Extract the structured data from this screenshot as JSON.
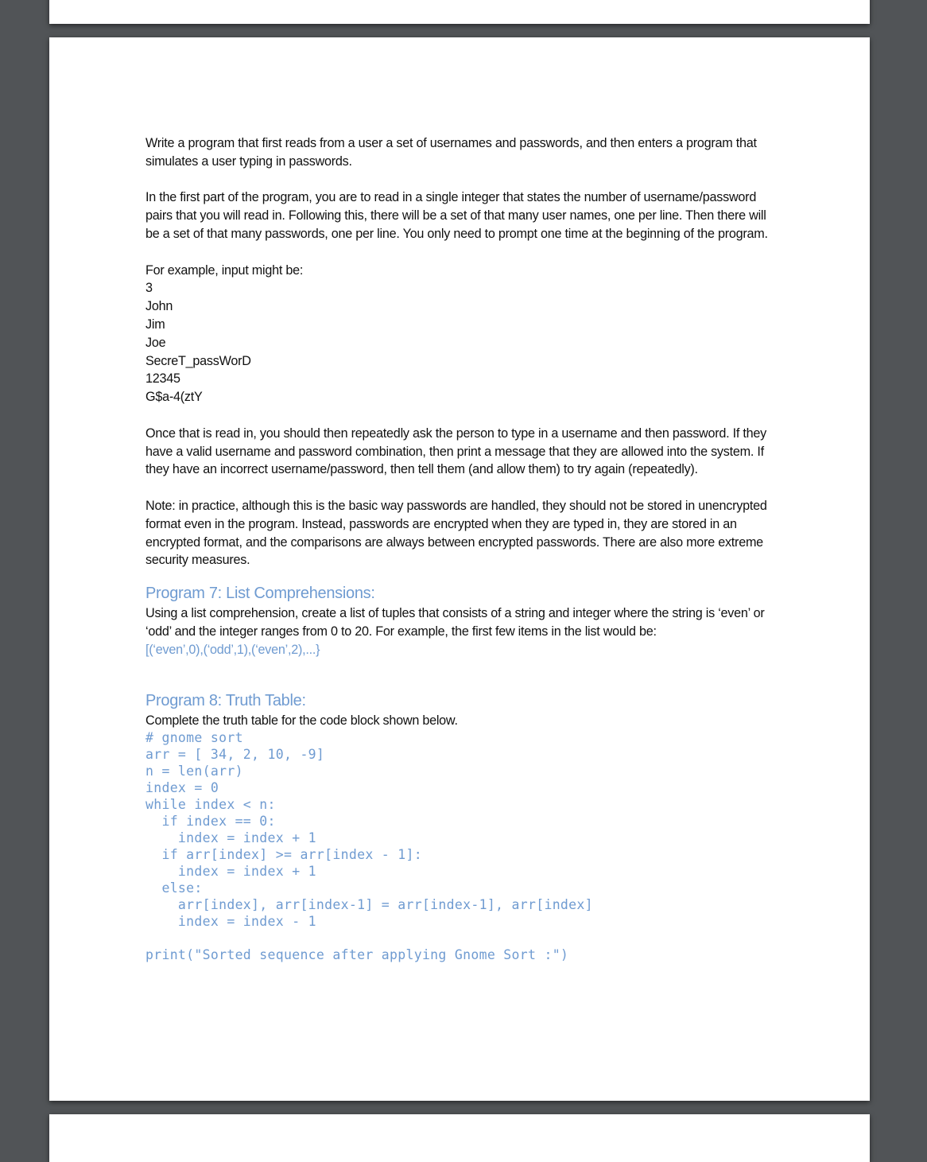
{
  "document": {
    "intro": [
      "Write a program that first reads from a user a set of usernames and passwords, and then enters a program that simulates a user typing in passwords.",
      "In the first part of the program, you are to read in a single integer that states the number of username/password pairs that you will read in.  Following this, there will be a set of that many user names, one per line.  Then there will be a set of that many passwords, one per line.  You only need to prompt one time at the beginning of the program."
    ],
    "example_label": "For example, input might be:",
    "example_lines": [
      "3",
      "John",
      "Jim",
      "Joe",
      "SecreT_passWorD",
      "12345",
      "G$a-4(ztY"
    ],
    "after_example": [
      "Once that is read in, you should then repeatedly ask the person to type in a username and then password.  If they have a valid username and password combination, then print a message that they are allowed into the system.  If they have an incorrect username/password, then tell them (and allow them) to try again (repeatedly).",
      "Note: in practice, although this is the basic way passwords are handled, they should not be stored in unencrypted format even in the program.  Instead, passwords are encrypted when they are typed in, they are stored in an encrypted format, and the comparisons are always between encrypted passwords.  There are also more extreme security measures."
    ],
    "program7": {
      "heading": "Program 7: List Comprehensions:",
      "body": "Using a list comprehension, create a list of tuples that consists of a string and integer where the string is ‘even’ or ‘odd’ and the integer ranges from 0 to 20. For example, the first few items in the list would be:",
      "example": "[(‘even’,0),(‘odd’,1),(‘even’,2),...}"
    },
    "program8": {
      "heading": "Program 8: Truth Table:",
      "body": "Complete the truth table for the code block shown below.",
      "code": [
        "# gnome sort",
        "arr = [ 34, 2, 10, -9]",
        "n = len(arr)",
        "index = 0",
        "while index < n:",
        "  if index == 0:",
        "    index = index + 1",
        "  if arr[index] >= arr[index - 1]:",
        "    index = index + 1",
        "  else:",
        "    arr[index], arr[index-1] = arr[index-1], arr[index]",
        "    index = index - 1",
        "",
        "print(\"Sorted sequence after applying Gnome Sort :\")"
      ]
    }
  },
  "colors": {
    "heading": "#6f9bd1",
    "code": "#6f9bd1",
    "background": "#515457",
    "page": "#ffffff"
  }
}
